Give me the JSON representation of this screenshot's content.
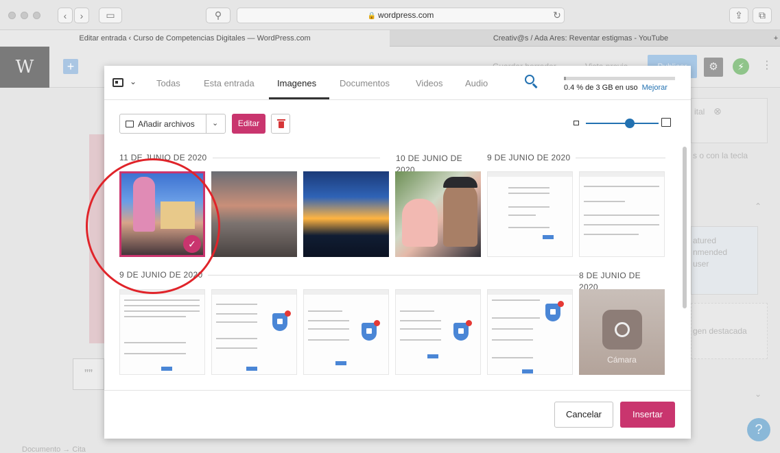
{
  "browser": {
    "url": "wordpress.com",
    "tabs": [
      {
        "label": "Editar entrada ‹ Curso de Competencias Digitales — WordPress.com"
      },
      {
        "label": "Creativ@s / Ada Ares: Reventar estigmas - YouTube"
      }
    ]
  },
  "editor": {
    "toolbar": {
      "drafts": "Guardar borrador",
      "preview": "Vista previa",
      "publish": "Publicar"
    },
    "sidebar": {
      "tag": "ital",
      "hint": "s o con la tecla",
      "featured_1": "atured",
      "featured_2": "nmended",
      "featured_3": "user",
      "featured_image": "gen destacada"
    },
    "breadcrumb": "Documento → Cita",
    "help": "?",
    "quote_icon": "””"
  },
  "media_modal": {
    "filter_tabs": [
      {
        "label": "Todas",
        "selected": false
      },
      {
        "label": "Esta entrada",
        "selected": false
      },
      {
        "label": "Imagenes",
        "selected": true
      },
      {
        "label": "Documentos",
        "selected": false
      },
      {
        "label": "Videos",
        "selected": false
      },
      {
        "label": "Audio",
        "selected": false
      }
    ],
    "storage": {
      "used_fraction": 0.004,
      "text": "0.4 % de 3 GB en uso",
      "upgrade": "Mejorar"
    },
    "upload_label": "Añadir archivos",
    "edit_label": "Editar",
    "zoom_level": 0.6,
    "groups": {
      "g1": "11 DE JUNIO DE 2020",
      "g2": "10 DE JUNIO DE 2020",
      "g3": "9 DE JUNIO DE 2020",
      "g4": "9 DE JUNIO DE 2020",
      "g5": "8 DE JUNIO DE 2020"
    },
    "camera_label": "Cámara",
    "cancel": "Cancelar",
    "insert": "Insertar"
  },
  "colors": {
    "accent": "#c9356e",
    "link": "#2271b1",
    "annotation": "#e0242a"
  },
  "icons": [
    "wordpress-logo-icon",
    "filter-icon",
    "search-icon",
    "upload-icon",
    "trash-icon",
    "check-icon",
    "camera-icon",
    "gear-icon",
    "jetpack-icon",
    "help-icon"
  ]
}
